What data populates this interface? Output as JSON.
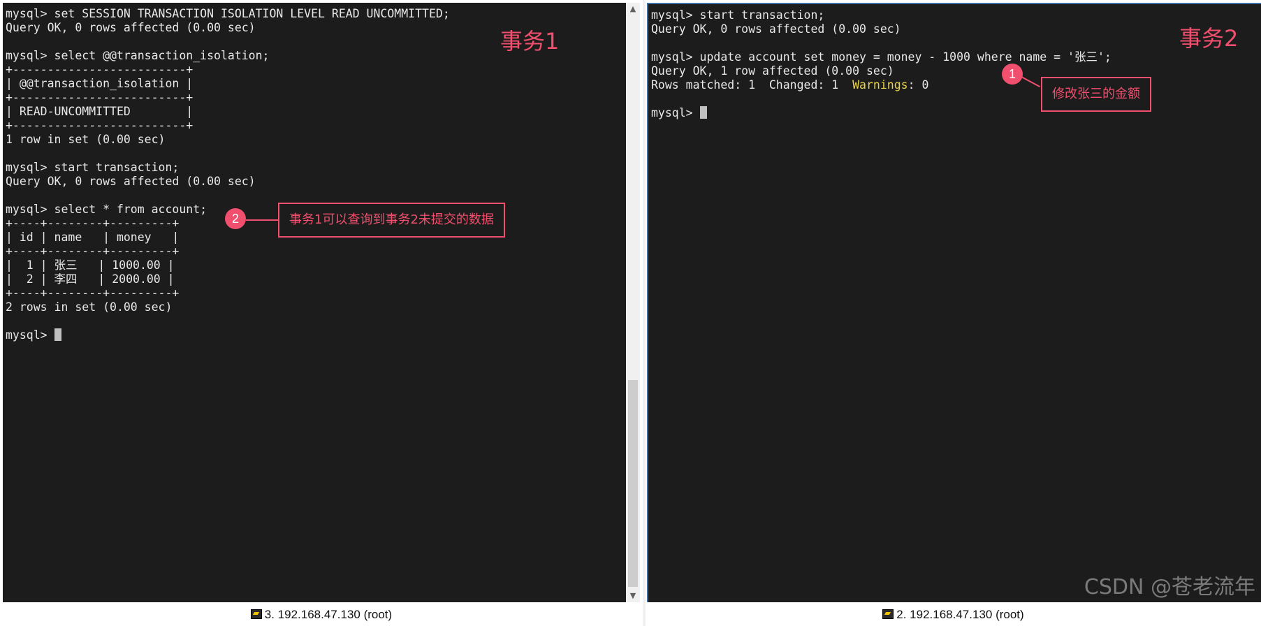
{
  "left_pane": {
    "lines": [
      "mysql> set SESSION TRANSACTION ISOLATION LEVEL READ UNCOMMITTED;",
      "Query OK, 0 rows affected (0.00 sec)",
      "",
      "mysql> select @@transaction_isolation;",
      "+-------------------------+",
      "| @@transaction_isolation |",
      "+-------------------------+",
      "| READ-UNCOMMITTED        |",
      "+-------------------------+",
      "1 row in set (0.00 sec)",
      "",
      "mysql> start transaction;",
      "Query OK, 0 rows affected (0.00 sec)",
      "",
      "mysql> select * from account;",
      "+----+--------+---------+",
      "| id | name   | money   |",
      "+----+--------+---------+",
      "|  1 | 张三   | 1000.00 |",
      "|  2 | 李四   | 2000.00 |",
      "+----+--------+---------+",
      "2 rows in set (0.00 sec)",
      "",
      "mysql> "
    ],
    "label": "事务1",
    "status": "3. 192.168.47.130 (root)",
    "annotation": {
      "number": "2",
      "text": "事务1可以查询到事务2未提交的数据"
    }
  },
  "right_pane": {
    "lines": [
      "mysql> start transaction;",
      "Query OK, 0 rows affected (0.00 sec)",
      "",
      "mysql> update account set money = money - 1000 where name = '张三';",
      "Query OK, 1 row affected (0.00 sec)",
      "Rows matched: 1  Changed: 1  ",
      "",
      "mysql> "
    ],
    "warnings_word": "Warnings",
    "warnings_rest": ": 0",
    "label": "事务2",
    "status": "2. 192.168.47.130 (root)",
    "annotation": {
      "number": "1",
      "text": "修改张三的金额"
    }
  },
  "watermark": "CSDN @苍老流年",
  "colors": {
    "accent": "#f0506e",
    "terminal_bg": "#1c1c1c",
    "terminal_text": "#e8e8e8",
    "warning": "#e8d34a"
  }
}
